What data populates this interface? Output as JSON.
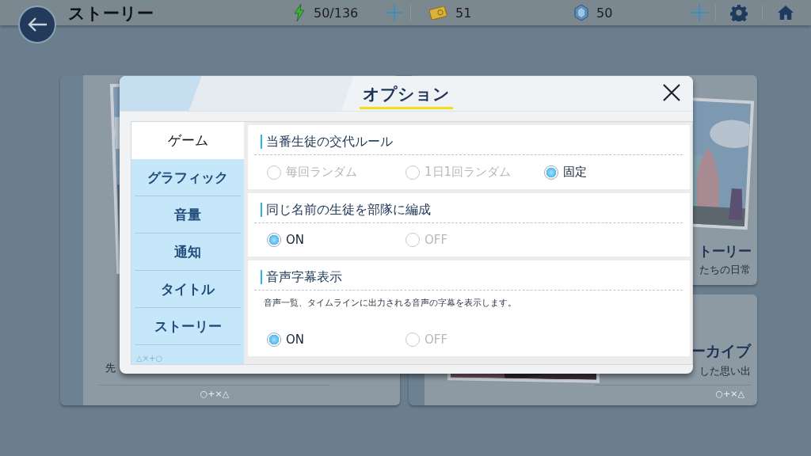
{
  "top_bar": {
    "title": "ストーリー",
    "resources": [
      {
        "kind": "energy",
        "value": "50/136",
        "has_add": true
      },
      {
        "kind": "credit",
        "value": "51",
        "has_add": false
      },
      {
        "kind": "gem",
        "value": "50",
        "has_add": true
      }
    ]
  },
  "background_cards": [
    {
      "kind": "left",
      "subtitle": "先",
      "footer": "○+×△"
    },
    {
      "kind": "top_right",
      "title": "トーリー",
      "subtitle": "たちの日常"
    },
    {
      "kind": "bottom_right",
      "title": "ーカイブ",
      "subtitle": "した思い出",
      "footer": "○+×△"
    }
  ],
  "dialog": {
    "title": "オプション",
    "tabs": [
      {
        "label": "ゲーム",
        "selected": true
      },
      {
        "label": "グラフィック",
        "selected": false
      },
      {
        "label": "音量",
        "selected": false
      },
      {
        "label": "通知",
        "selected": false
      },
      {
        "label": "タイトル",
        "selected": false
      },
      {
        "label": "ストーリー",
        "selected": false
      }
    ],
    "tab_mark": "△×+○",
    "sections": [
      {
        "title": "当番生徒の交代ルール",
        "options": [
          {
            "label": "毎回ランダム",
            "selected": false
          },
          {
            "label": "1日1回ランダム",
            "selected": false
          },
          {
            "label": "固定",
            "selected": true
          }
        ]
      },
      {
        "title": "同じ名前の生徒を部隊に編成",
        "options": [
          {
            "label": "ON",
            "selected": true
          },
          {
            "label": "OFF",
            "selected": false
          }
        ]
      },
      {
        "title": "音声字幕表示",
        "description": "音声一覧、タイムラインに出力される音声の字幕を表示します。",
        "options": [
          {
            "label": "ON",
            "selected": true
          },
          {
            "label": "OFF",
            "selected": false
          }
        ]
      }
    ]
  }
}
